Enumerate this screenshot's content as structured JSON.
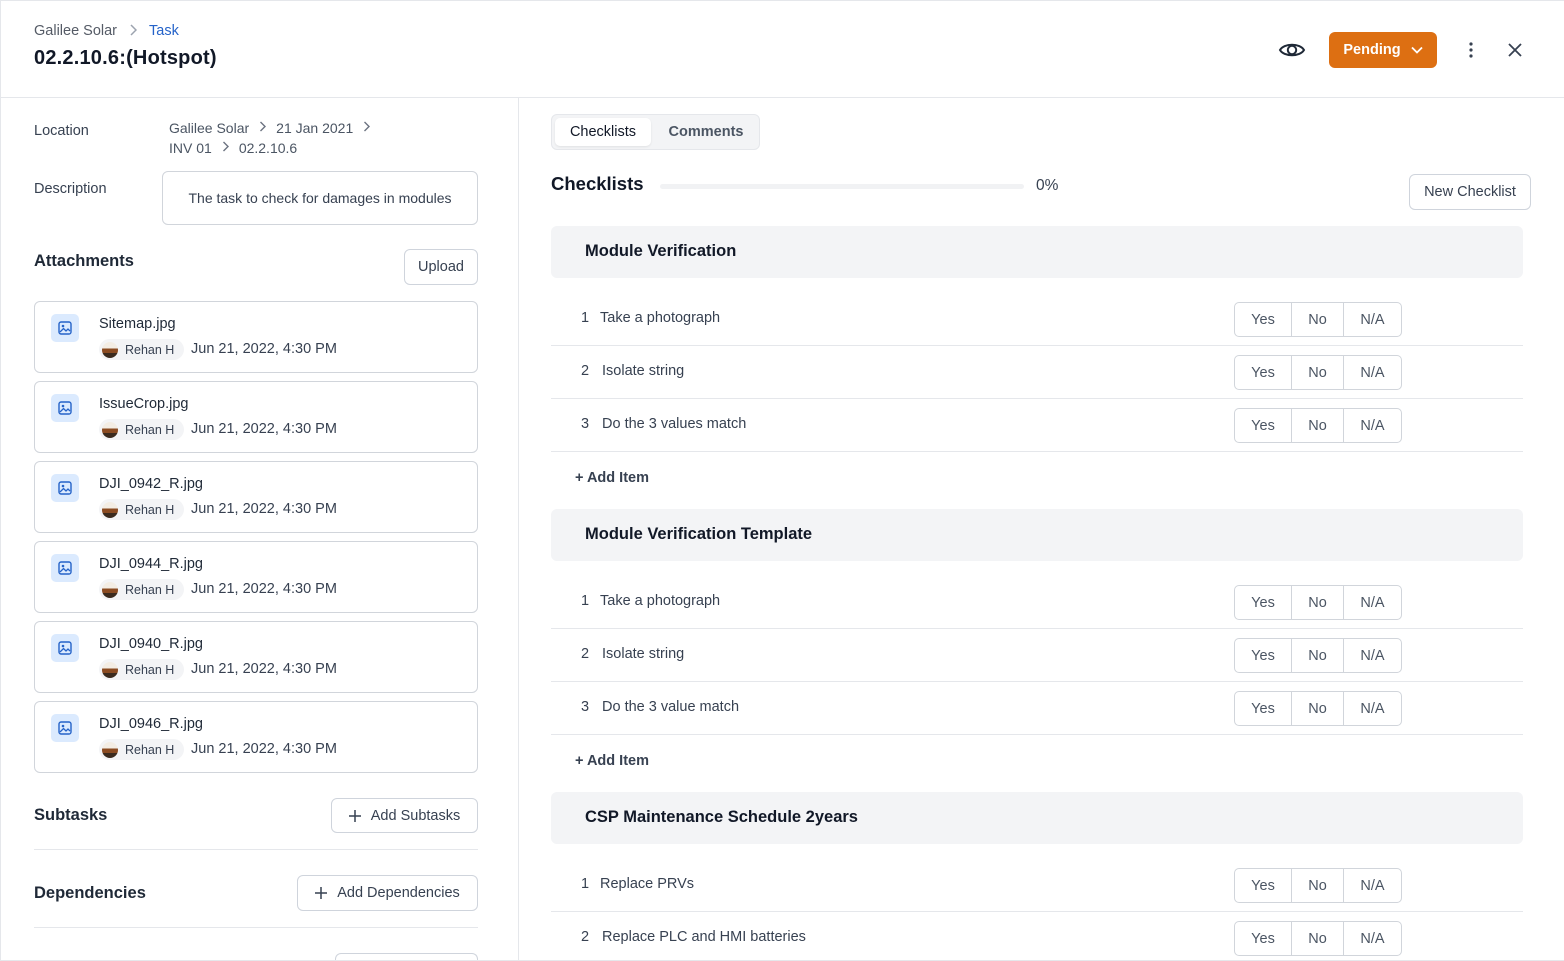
{
  "header": {
    "breadcrumb": {
      "root": "Galilee Solar",
      "current": "Task"
    },
    "title": "02.2.10.6:(Hotspot)",
    "status": "Pending",
    "accent_color": "#dd6f12",
    "link_color": "#2563c9"
  },
  "left": {
    "location_label": "Location",
    "location_path": [
      "Galilee Solar",
      "21 Jan 2021",
      "INV 01",
      "02.2.10.6"
    ],
    "description_label": "Description",
    "description": "The task to check for damages in modules",
    "attachments_title": "Attachments",
    "upload_label": "Upload",
    "attachments": [
      {
        "name": "Sitemap.jpg",
        "user": "Rehan H",
        "date": "Jun 21, 2022, 4:30 PM"
      },
      {
        "name": "IssueCrop.jpg",
        "user": "Rehan H",
        "date": "Jun 21, 2022, 4:30 PM"
      },
      {
        "name": "DJI_0942_R.jpg",
        "user": "Rehan H",
        "date": "Jun 21, 2022, 4:30 PM"
      },
      {
        "name": "DJI_0944_R.jpg",
        "user": "Rehan H",
        "date": "Jun 21, 2022, 4:30 PM"
      },
      {
        "name": "DJI_0940_R.jpg",
        "user": "Rehan H",
        "date": "Jun 21, 2022, 4:30 PM"
      },
      {
        "name": "DJI_0946_R.jpg",
        "user": "Rehan H",
        "date": "Jun 21, 2022, 4:30 PM"
      }
    ],
    "subtasks_title": "Subtasks",
    "add_subtasks_label": "Add Subtasks",
    "dependencies_title": "Dependencies",
    "add_dependencies_label": "Add Dependencies"
  },
  "right": {
    "tabs": [
      "Checklists",
      "Comments"
    ],
    "checklists_title": "Checklists",
    "progress_fraction": 0,
    "progress_text": "0%",
    "new_checklist_label": "New Checklist",
    "answer_options": [
      "Yes",
      "No",
      "N/A"
    ],
    "add_item_label": "+ Add Item",
    "checklists": [
      {
        "name": "Module Verification",
        "items": [
          "Take a photograph",
          "Isolate string",
          "Do the 3 values match"
        ]
      },
      {
        "name": "Module Verification Template",
        "items": [
          "Take a photograph",
          "Isolate string",
          "Do the 3 value match"
        ]
      },
      {
        "name": "CSP Maintenance Schedule 2years",
        "items": [
          "Replace PRVs",
          "Replace PLC and HMI batteries"
        ]
      }
    ]
  }
}
